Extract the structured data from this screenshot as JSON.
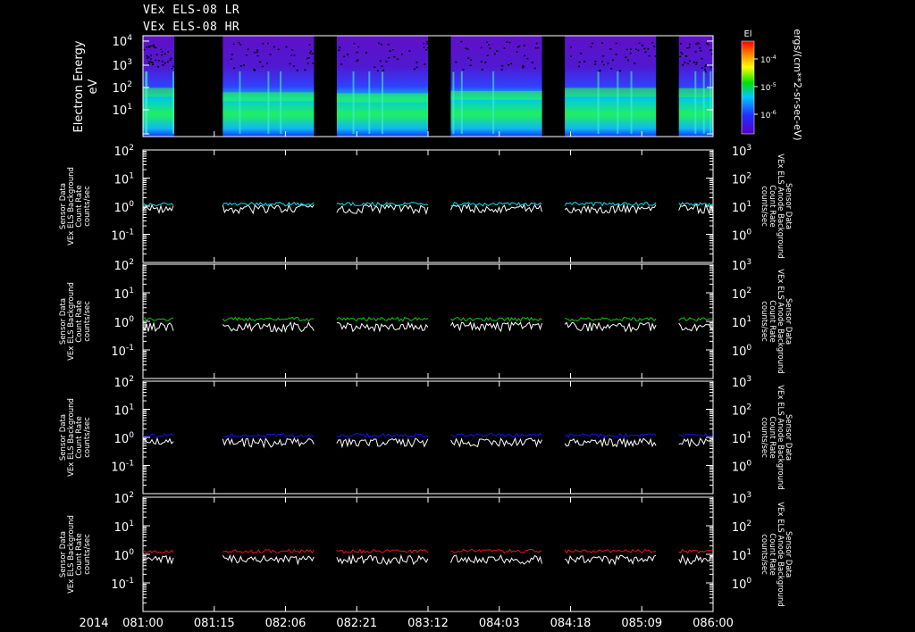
{
  "titles": [
    "VEx ELS-08 LR",
    "VEx ELS-08 HR"
  ],
  "colors": {
    "background": "#000000",
    "frame": "#ffffff",
    "white_trace": "#ffffff",
    "cyan": "#00e5ee",
    "green": "#00d000",
    "blue": "#1010ff",
    "red": "#ee1010"
  },
  "spectrogram": {
    "ylabel_line1": "Electron Energy",
    "ylabel_line2": "eV",
    "ytick_labels": [
      "10",
      "10",
      "10",
      "10",
      "10"
    ],
    "ytick_exponents": [
      "4",
      "3",
      "2",
      "1",
      ""
    ],
    "colorbar_label": "El",
    "colorbar_unit": "ergs/(cm**2-sr-sec-eV)",
    "colorbar_ticks": [
      "10",
      "10",
      "10"
    ],
    "colorbar_exponents": [
      "-4",
      "-5",
      "-6"
    ]
  },
  "time_axis": {
    "year": "2014",
    "labels": [
      "081:00",
      "081:15",
      "082:06",
      "082:21",
      "083:12",
      "084:03",
      "084:18",
      "085:09",
      "086:00"
    ]
  },
  "panel_axes": {
    "left_ticks": [
      "10",
      "10",
      "10",
      "10"
    ],
    "left_exponents": [
      "2",
      "1",
      "0",
      "-1"
    ],
    "right_ticks": [
      "10",
      "10",
      "10",
      "10"
    ],
    "right_exponents": [
      "3",
      "2",
      "1",
      "0"
    ]
  },
  "chart_data": {
    "type": "line",
    "title": "VEx ELS-08 LR / VEx ELS-08 HR",
    "x": [
      "081:00",
      "081:15",
      "082:06",
      "082:21",
      "083:12",
      "084:03",
      "084:18",
      "085:09",
      "086:00"
    ],
    "data_segments_x_fraction": [
      [
        0.0,
        0.055
      ],
      [
        0.14,
        0.3
      ],
      [
        0.34,
        0.5
      ],
      [
        0.54,
        0.7
      ],
      [
        0.74,
        0.9
      ],
      [
        0.94,
        1.0
      ]
    ],
    "panels": [
      {
        "left_label": [
          "Sensor Data",
          "VEx ELS Background",
          "Count Rate",
          "counts/sec"
        ],
        "right_label": [
          "Sensor Data",
          "VEx ELS Anode Background",
          "Count Rate",
          "counts/sec"
        ],
        "color": "#00e5ee",
        "ylim_left": [
          0.01,
          100
        ],
        "ylim_right": [
          0.1,
          1000
        ],
        "series": [
          {
            "name": "Sensor Data",
            "typical_value": 1.0
          },
          {
            "name": "VEx ELS Anode Background",
            "typical_value": 12
          }
        ]
      },
      {
        "left_label": [
          "Sensor Data",
          "VEx ELS Background",
          "Count Rate",
          "counts/sec"
        ],
        "right_label": [
          "Sensor Data",
          "VEx ELS Anode Background",
          "Count Rate",
          "counts/sec"
        ],
        "color": "#00d000",
        "ylim_left": [
          0.01,
          100
        ],
        "ylim_right": [
          0.1,
          1000
        ],
        "series": [
          {
            "name": "Sensor Data",
            "typical_value": 0.8
          },
          {
            "name": "VEx ELS Anode Background",
            "typical_value": 12
          }
        ]
      },
      {
        "left_label": [
          "Sensor Data",
          "VEx ELS Background",
          "Count Rate",
          "counts/sec"
        ],
        "right_label": [
          "Sensor Data",
          "VEx ELS Anode Background",
          "Count Rate",
          "counts/sec"
        ],
        "color": "#1010ff",
        "ylim_left": [
          0.01,
          100
        ],
        "ylim_right": [
          0.1,
          1000
        ],
        "series": [
          {
            "name": "Sensor Data",
            "typical_value": 0.8
          },
          {
            "name": "VEx ELS Anode Background",
            "typical_value": 12
          }
        ]
      },
      {
        "left_label": [
          "Sensor Data",
          "VEx ELS Background",
          "Count Rate",
          "counts/sec"
        ],
        "right_label": [
          "Sensor Data",
          "VEx ELS Anode Background",
          "Count Rate",
          "counts/sec"
        ],
        "color": "#ee1010",
        "ylim_left": [
          0.01,
          100
        ],
        "ylim_right": [
          0.1,
          1000
        ],
        "series": [
          {
            "name": "Sensor Data",
            "typical_value": 0.8
          },
          {
            "name": "VEx ELS Anode Background",
            "typical_value": 13
          }
        ]
      }
    ]
  }
}
